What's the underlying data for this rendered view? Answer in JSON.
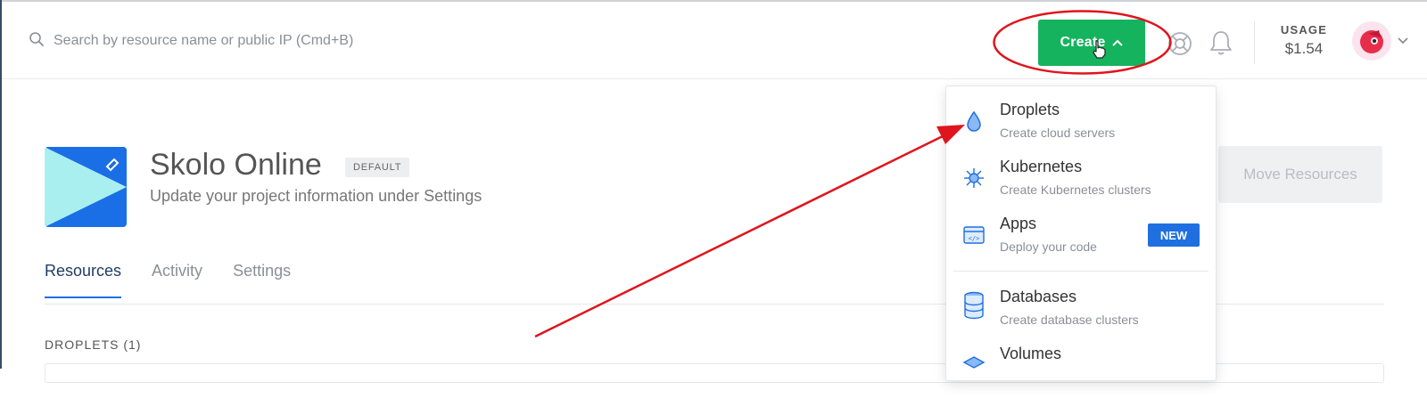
{
  "header": {
    "search_placeholder": "Search by resource name or public IP (Cmd+B)",
    "create_label": "Create",
    "usage_label": "USAGE",
    "usage_value": "$1.54"
  },
  "project": {
    "name": "Skolo Online",
    "badge": "DEFAULT",
    "subtitle": "Update your project information under Settings",
    "move_button": "Move Resources"
  },
  "tabs": [
    {
      "label": "Resources",
      "active": true
    },
    {
      "label": "Activity",
      "active": false
    },
    {
      "label": "Settings",
      "active": false
    }
  ],
  "section": {
    "droplets_label": "DROPLETS (1)"
  },
  "create_menu": {
    "items": [
      {
        "title": "Droplets",
        "description": "Create cloud servers",
        "icon": "droplet-icon"
      },
      {
        "title": "Kubernetes",
        "description": "Create Kubernetes clusters",
        "icon": "kubernetes-icon"
      },
      {
        "title": "Apps",
        "description": "Deploy your code",
        "icon": "apps-icon",
        "badge": "NEW"
      },
      {
        "title": "Databases",
        "description": "Create database clusters",
        "icon": "database-icon"
      },
      {
        "title": "Volumes",
        "description": "",
        "icon": "volume-icon"
      }
    ]
  },
  "colors": {
    "create_green": "#15b35e",
    "link_blue": "#1f6fe0",
    "annotation_red": "#e0141c"
  }
}
